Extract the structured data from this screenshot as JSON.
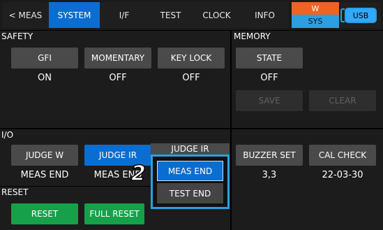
{
  "tabs": {
    "meas": "< MEAS",
    "system": "SYSTEM",
    "if": "I/F",
    "test": "TEST",
    "clock": "CLOCK",
    "info": "INFO"
  },
  "status": {
    "w_label": "W",
    "sys_label": "SYS",
    "usb_label": "USB"
  },
  "safety": {
    "title": "SAFETY",
    "gfi_label": "GFI",
    "gfi_value": "ON",
    "momentary_label": "MOMENTARY",
    "momentary_value": "OFF",
    "keylock_label": "KEY LOCK",
    "keylock_value": "OFF"
  },
  "memory": {
    "title": "MEMORY",
    "state_label": "STATE",
    "state_value": "OFF",
    "save_label": "SAVE",
    "clear_label": "CLEAR"
  },
  "io": {
    "title": "I/O",
    "judge_w_label": "JUDGE W",
    "judge_w_value": "MEAS END",
    "judge_ir_label": "JUDGE IR",
    "judge_ir_value": "MEAS END"
  },
  "popup": {
    "header": "JUDGE IR",
    "options": [
      "MEAS END",
      "TEST END"
    ],
    "selected": "MEAS END"
  },
  "step_marker": "2",
  "buzzer": {
    "label": "BUZZER SET",
    "value": "3,3"
  },
  "cal": {
    "label": "CAL CHECK",
    "value": "22-03-30"
  },
  "reset": {
    "title": "RESET",
    "reset_label": "RESET",
    "full_reset_label": "FULL RESET"
  },
  "colors": {
    "accent_blue": "#0a6ed1",
    "reset_green": "#16a04a",
    "w_orange": "#ee6422",
    "sys_blue": "#2b9fe0"
  }
}
